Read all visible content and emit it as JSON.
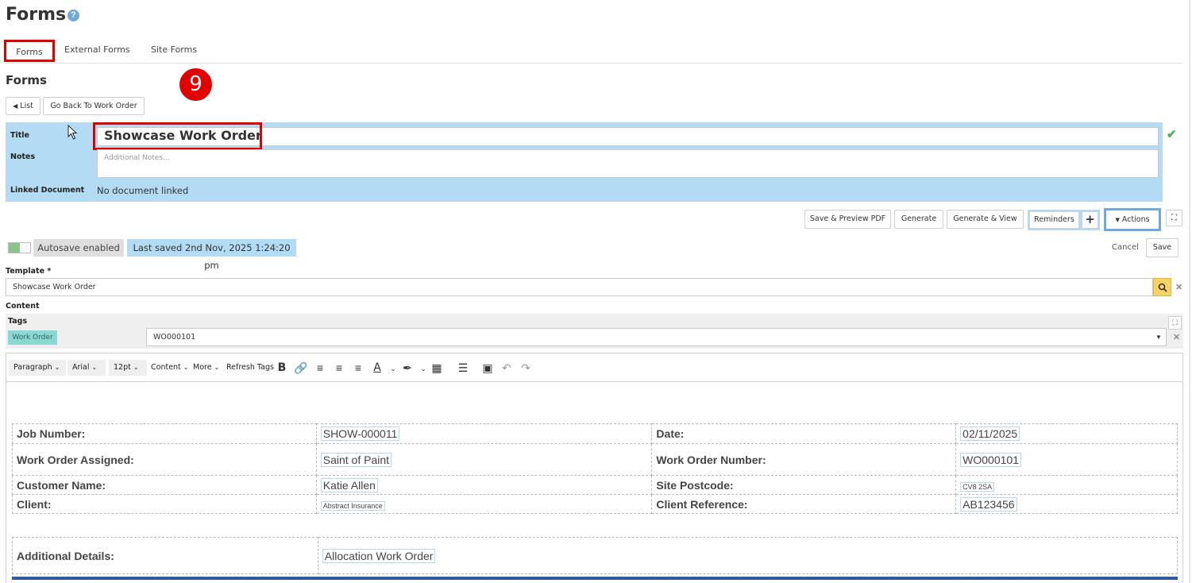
{
  "header": {
    "title": "Forms",
    "help_icon": "?"
  },
  "tabs": [
    {
      "label": "Forms"
    },
    {
      "label": "External Forms"
    },
    {
      "label": "Site Forms"
    }
  ],
  "section_title": "Forms",
  "step_badge": "9",
  "nav_buttons": {
    "list": "List",
    "go_back": "Go Back To Work Order"
  },
  "form_info": {
    "title_label": "Title",
    "title_value": "Showcase Work Order",
    "notes_label": "Notes",
    "notes_placeholder": "Additional Notes...",
    "linked_label": "Linked Document",
    "linked_value": "No document linked"
  },
  "toolbar": {
    "save_preview": "Save & Preview PDF",
    "generate": "Generate",
    "generate_view": "Generate & View",
    "reminders": "Reminders",
    "plus": "+",
    "actions": "Actions"
  },
  "status": {
    "autosave": "Autosave enabled",
    "last_saved": "Last saved 2nd Nov, 2025 1:24:20 pm",
    "cancel": "Cancel",
    "save": "Save"
  },
  "template": {
    "label": "Template *",
    "value": "Showcase Work Order"
  },
  "content_label": "Content",
  "tags": {
    "label": "Tags",
    "chip": "Work Order",
    "selected": "WO000101"
  },
  "editor_toolbar": {
    "paragraph": "Paragraph",
    "font": "Arial",
    "size": "12pt",
    "content": "Content",
    "more": "More",
    "refresh_tags": "Refresh Tags"
  },
  "document": {
    "rows": [
      {
        "l1": "Job Number:",
        "v1": "SHOW-000011",
        "l2": "Date:",
        "v2": "02/11/2025"
      },
      {
        "l1": "Work Order Assigned:",
        "v1": "Saint of Paint",
        "l2": "Work Order Number:",
        "v2": "WO000101"
      },
      {
        "l1": "Customer Name:",
        "v1": "Katie Allen",
        "l2": "Site Postcode:",
        "v2": "CV8 2SA"
      },
      {
        "l1": "Client:",
        "v1": "Abstract Insurance",
        "l2": "Client Reference:",
        "v2": "AB123456"
      }
    ],
    "additional": {
      "label": "Additional Details:",
      "value": "Allocation Work Order"
    }
  },
  "colors": {
    "accent_red": "#e00000",
    "panel_blue": "#b3dcf4",
    "tag_teal": "#8bd8d2"
  }
}
